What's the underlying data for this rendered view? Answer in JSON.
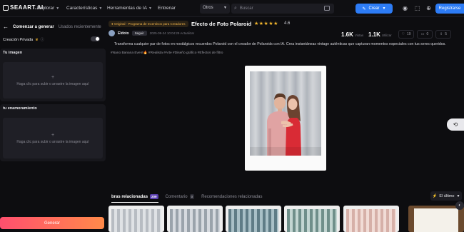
{
  "header": {
    "logo": "SEAART.AI",
    "nav": [
      {
        "label": "Explorar"
      },
      {
        "label": "Características"
      },
      {
        "label": "Herramientas de IA"
      },
      {
        "label": "Entrenar"
      }
    ],
    "category_select": "Otros",
    "search_placeholder": "Buscar",
    "create_label": "Crear",
    "register_label": "Registrarse"
  },
  "left_panel": {
    "tab_active": "Comenzar a generar",
    "tab_inactive": "Usados recientemente",
    "private_label": "Creación Privada",
    "private_enabled": false,
    "image_section": {
      "title": "Tu imagen",
      "upload_text": "Haga clic para subir o arrastre la imagen aquí"
    },
    "partner_section": {
      "title": "tu enamoramiento",
      "upload_text": "Haga clic para subir o arrastre la imagen aquí"
    },
    "generate_label": "Generar"
  },
  "main": {
    "badge": "Original · Programa de Incentivos para Creadores",
    "title": "Efecto de Foto Polaroid",
    "rating_value": 4.6,
    "rating_text": "4.6",
    "author": "Eldoto",
    "follow_label": "Seguir",
    "date": "2025-09-24 10:04:29 Actualizar",
    "stats": [
      {
        "value": "1.6K",
        "label": "Vistas"
      },
      {
        "value": "1.1K",
        "label": "Utilizar"
      }
    ],
    "actions": [
      {
        "icon": "heart-icon",
        "count": "19"
      },
      {
        "icon": "comment-icon",
        "count": "0"
      },
      {
        "icon": "share-icon",
        "count": "5"
      }
    ],
    "description": "Transforma cualquier par de fotos en nostálgicos recuerdos Polaroid con el creador de Polaroids con IA. Crea instantáneas vintage auténticas que capturan momentos especiales con tus seres queridos.",
    "tags": "#Nano Banana Event🔥  #Realista  #Arte  #Diseño gráfico  #Efectos de filtro"
  },
  "bottom": {
    "tabs": [
      {
        "label": "bras relacionadas",
        "count": "209"
      },
      {
        "label": "Comentario",
        "count": "0"
      },
      {
        "label": "Recomendaciones relacionadas",
        "count": ""
      }
    ],
    "sort_label": "El último"
  },
  "colors": {
    "accent": "#2d7cf6",
    "generate_start": "#ff4f6e",
    "generate_end": "#ff8a4a",
    "badge": "#f0b34a",
    "star": "#f5b82e"
  }
}
